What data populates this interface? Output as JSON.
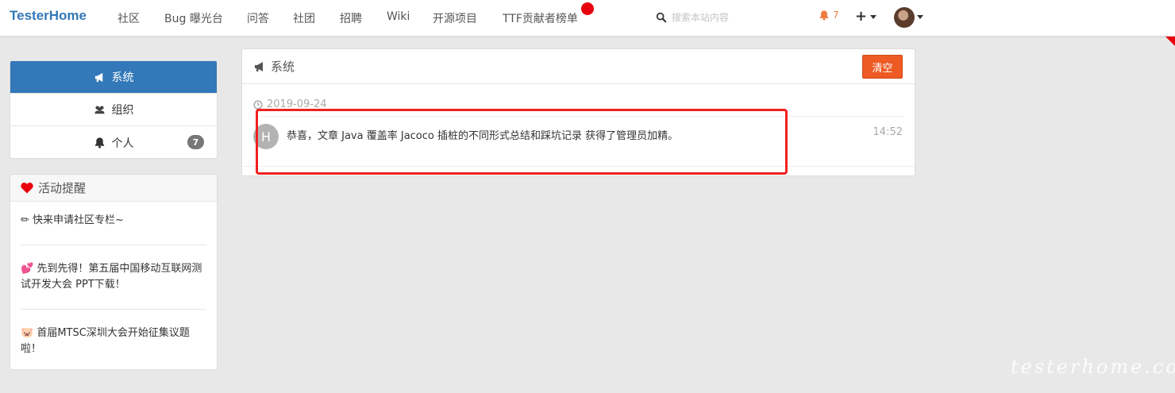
{
  "navbar": {
    "brand": "TesterHome",
    "items": [
      "社区",
      "Bug 曝光台",
      "问答",
      "社团",
      "招聘",
      "Wiki",
      "开源项目",
      "TTF贡献者榜单"
    ],
    "search_placeholder": "搜索本站内容",
    "notifications_count": "7",
    "icons": [
      "search-icon",
      "bell-icon",
      "plus-icon",
      "avatar"
    ]
  },
  "sidebar": {
    "items": [
      {
        "label": "系统",
        "icon": "bullhorn-icon",
        "active": true
      },
      {
        "label": "组织",
        "icon": "users-icon"
      },
      {
        "label": "个人",
        "icon": "bell-icon",
        "badge": "7"
      }
    ]
  },
  "activity": {
    "title": "活动提醒",
    "items": [
      {
        "icon": "pencil-icon",
        "text": "快来申请社区专栏~"
      },
      {
        "icon": "hearts-icon",
        "text": "先到先得！第五届中国移动互联网测试开发大会 PPT下载！"
      },
      {
        "icon": "pig-icon",
        "text": "首届MTSC深圳大会开始征集议题啦！"
      }
    ]
  },
  "main": {
    "title": "系统",
    "clear_label": "清空",
    "date": "2019-09-24",
    "notification": {
      "avatar_letter": "H",
      "text": "恭喜，文章 Java 覆盖率 Jacoco 插桩的不同形式总结和踩坑记录 获得了管理员加精。",
      "time": "14:52"
    }
  },
  "watermark": "testerhome.com",
  "colors": {
    "brand": "#3378b8",
    "active": "#3378b8",
    "clear_button": "#ee5a24",
    "highlight": "#f0211f",
    "notification": "#f07b3f"
  }
}
